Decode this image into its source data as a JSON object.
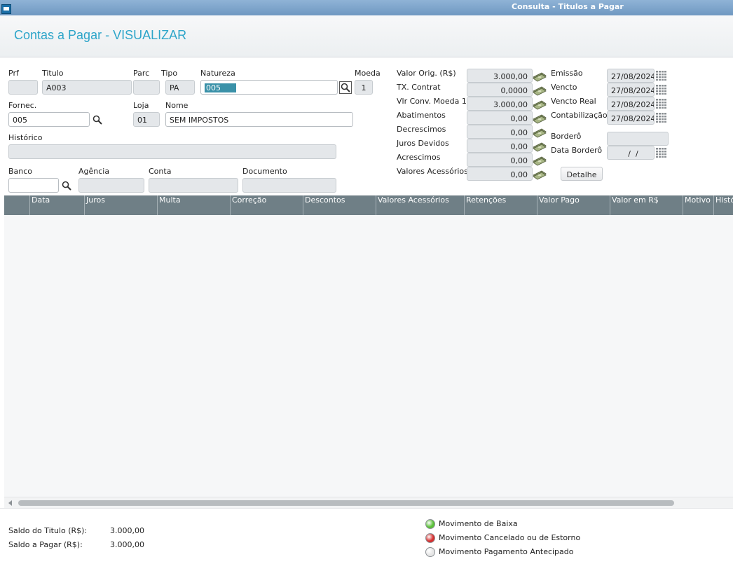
{
  "window": {
    "title": "Consulta - Titulos a Pagar"
  },
  "page": {
    "title": "Contas a Pagar - VISUALIZAR"
  },
  "form": {
    "prf": {
      "label": "Prf",
      "value": ""
    },
    "titulo": {
      "label": "Titulo",
      "value": "A003"
    },
    "parc": {
      "label": "Parc",
      "value": ""
    },
    "tipo": {
      "label": "Tipo",
      "value": "PA"
    },
    "natureza": {
      "label": "Natureza",
      "value": "005"
    },
    "moeda": {
      "label": "Moeda",
      "value": "1"
    },
    "fornec": {
      "label": "Fornec.",
      "value": "005"
    },
    "loja": {
      "label": "Loja",
      "value": "01"
    },
    "nome": {
      "label": "Nome",
      "value": "SEM IMPOSTOS"
    },
    "historico": {
      "label": "Histórico",
      "value": ""
    },
    "banco": {
      "label": "Banco",
      "value": ""
    },
    "agencia": {
      "label": "Agência",
      "value": ""
    },
    "conta": {
      "label": "Conta",
      "value": ""
    },
    "documento": {
      "label": "Documento",
      "value": ""
    }
  },
  "values": [
    {
      "label": "Valor Orig. (R$)",
      "value": "3.000,00"
    },
    {
      "label": "TX. Contrat",
      "value": "0,0000"
    },
    {
      "label": "Vlr Conv. Moeda 1",
      "value": "3.000,00"
    },
    {
      "label": "Abatimentos",
      "value": "0,00"
    },
    {
      "label": "Decrescimos",
      "value": "0,00"
    },
    {
      "label": "Juros Devidos",
      "value": "0,00"
    },
    {
      "label": "Acrescimos",
      "value": "0,00"
    },
    {
      "label": "Valores Acessórios",
      "value": "0,00"
    }
  ],
  "dates": [
    {
      "label": "Emissão",
      "value": "27/08/2024"
    },
    {
      "label": "Vencto",
      "value": "27/08/2024"
    },
    {
      "label": "Vencto Real",
      "value": "27/08/2024"
    },
    {
      "label": "Contabilização",
      "value": "27/08/2024"
    }
  ],
  "bordero": {
    "label": "Borderô",
    "value": ""
  },
  "data_bordero": {
    "label": "Data Borderô",
    "value": "  /  /"
  },
  "detalhe_button": "Detalhe",
  "table": {
    "columns": [
      "Data",
      "Juros",
      "Multa",
      "Correção",
      "Descontos",
      "Valores Acessórios",
      "Retenções",
      "Valor Pago",
      "Valor em R$",
      "Motivo",
      "Histó"
    ],
    "rows": []
  },
  "footer": {
    "saldo_titulo_label": "Saldo do Titulo (R$):",
    "saldo_titulo_value": "3.000,00",
    "saldo_pagar_label": "Saldo a Pagar (R$):",
    "saldo_pagar_value": "3.000,00"
  },
  "legend": [
    {
      "label": "Movimento de Baixa",
      "color": "#5cc13a"
    },
    {
      "label": "Movimento Cancelado ou de Estorno",
      "color": "#d62f2f"
    },
    {
      "label": "Movimento Pagamento Antecipado",
      "color": "#e6e6e6"
    }
  ],
  "colors": {
    "accent": "#2da5c9",
    "grid_header": "#6f7f86"
  }
}
